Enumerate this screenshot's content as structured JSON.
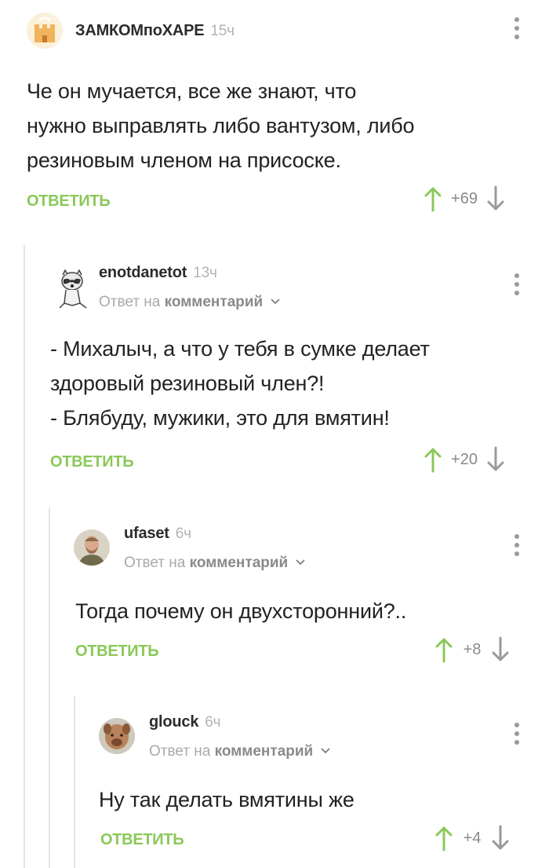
{
  "comments": [
    {
      "username": "ЗАМКОМпоХАРЕ",
      "time": "15ч",
      "text": "Че он мучается, все же знают, что\nнужно выправлять либо вантузом, либо\nрезиновым членом на присоске.",
      "reply_label": "ОТВЕТИТЬ",
      "score": "+69"
    },
    {
      "username": "enotdanetot",
      "time": "13ч",
      "reply_prefix": "Ответ на",
      "reply_target": "комментарий",
      "text": "- Михалыч, а что у тебя в сумке делает\nздоровый резиновый член?!\n- Блябуду, мужики, это для вмятин!",
      "reply_label": "ОТВЕТИТЬ",
      "score": "+20"
    },
    {
      "username": "ufaset",
      "time": "6ч",
      "reply_prefix": "Ответ на",
      "reply_target": "комментарий",
      "text": "Тогда почему он двухсторонний?..",
      "reply_label": "ОТВЕТИТЬ",
      "score": "+8"
    },
    {
      "username": "glouck",
      "time": "6ч",
      "reply_prefix": "Ответ на",
      "reply_target": "комментарий",
      "text": "Ну так делать вмятины же",
      "reply_label": "ОТВЕТИТЬ",
      "score": "+4"
    }
  ],
  "colors": {
    "accent_green": "#8ac858",
    "thread_line": "#e4e4e4",
    "muted_text": "#a9a9a9"
  },
  "icons": [
    "more-vertical-icon",
    "upvote-arrow-icon",
    "downvote-arrow-icon",
    "chevron-down-icon"
  ]
}
